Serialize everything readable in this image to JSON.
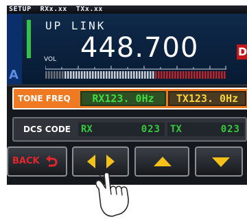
{
  "header": {
    "setup_text": "SETUP  RXx.xx  TXx.xx"
  },
  "display": {
    "band_label": "UP LINK",
    "vol_label": "VOL",
    "frequency": "448.700",
    "mode_icon_text": "DN",
    "s_meter_level": 0.6,
    "corner_glyph": "A"
  },
  "tone_freq": {
    "label": "TONE FREQ",
    "rx_value": "RX123. 0Hz",
    "tx_value": "TX123. 0Hz"
  },
  "dcs_code": {
    "label": "DCS CODE",
    "rx_tag": "RX",
    "rx_value": "023",
    "tx_tag": "TX",
    "tx_value": "023"
  },
  "buttons": {
    "back_label": "BACK",
    "left_right_icon": "left-right-arrows-icon",
    "up_icon": "up-arrow-icon",
    "down_icon": "down-arrow-icon"
  },
  "colors": {
    "accent_orange": "#ef7a22",
    "rx_green": "#3fdc3f",
    "tx_yellow": "#f7d33a",
    "back_red": "#e4262c",
    "arrow_yellow": "#f6c21a"
  }
}
